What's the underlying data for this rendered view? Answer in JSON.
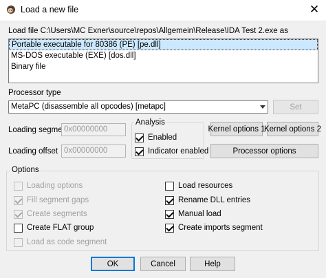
{
  "window": {
    "title": "Load a new file",
    "close_glyph": "✕"
  },
  "load_file": {
    "label": "Load file C:\\Users\\MC Exner\\source\\repos\\Allgemein\\Release\\IDA Test 2.exe as",
    "items": [
      {
        "label": "Portable executable for 80386 (PE) [pe.dll]",
        "selected": true
      },
      {
        "label": "MS-DOS executable (EXE) [dos.dll]",
        "selected": false
      },
      {
        "label": "Binary file",
        "selected": false
      }
    ]
  },
  "processor": {
    "label": "Processor type",
    "selected": "MetaPC (disassemble all opcodes) [metapc]",
    "set_button": "Set"
  },
  "segments": {
    "loading_segment_label": "Loading segment",
    "loading_segment_value": "0x00000000",
    "loading_offset_label": "Loading offset",
    "loading_offset_value": "0x00000000"
  },
  "analysis": {
    "title": "Analysis",
    "enabled_label": "Enabled",
    "indicator_label": "Indicator enabled"
  },
  "side_buttons": {
    "kernel1": "Kernel options 1",
    "kernel2": "Kernel options 2",
    "processor_options": "Processor options"
  },
  "options": {
    "title": "Options",
    "left": [
      {
        "label": "Loading options",
        "checked": false,
        "disabled": true
      },
      {
        "label": "Fill segment gaps",
        "checked": true,
        "disabled": true
      },
      {
        "label": "Create segments",
        "checked": true,
        "disabled": true
      },
      {
        "label": "Create FLAT group",
        "checked": false,
        "disabled": false
      },
      {
        "label": "Load as code segment",
        "checked": false,
        "disabled": true
      }
    ],
    "right": [
      {
        "label": "Load resources",
        "checked": false,
        "disabled": false
      },
      {
        "label": "Rename DLL entries",
        "checked": true,
        "disabled": false
      },
      {
        "label": "Manual load",
        "checked": true,
        "disabled": false
      },
      {
        "label": "Create imports segment",
        "checked": true,
        "disabled": false
      }
    ]
  },
  "footer": {
    "ok": "OK",
    "cancel": "Cancel",
    "help": "Help"
  },
  "colors": {
    "selection": "#cce8ff",
    "default_button_border": "#0078d7"
  }
}
